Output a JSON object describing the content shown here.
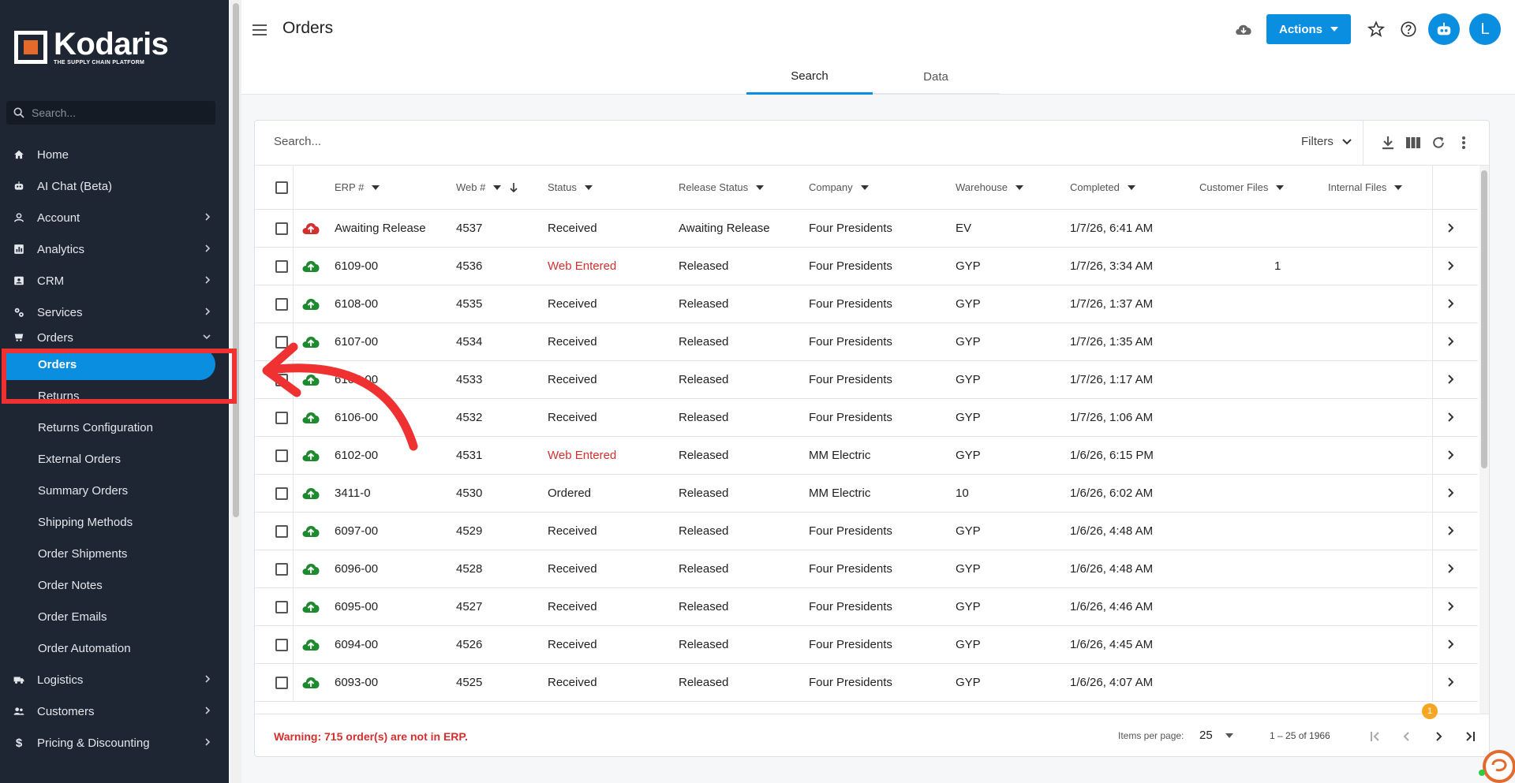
{
  "brand": {
    "name": "Kodaris",
    "tagline": "THE SUPPLY CHAIN PLATFORM"
  },
  "sidebar": {
    "search_placeholder": "Search...",
    "items": [
      {
        "label": "Home",
        "icon": "home-icon"
      },
      {
        "label": "AI Chat (Beta)",
        "icon": "robot-icon"
      },
      {
        "label": "Account",
        "icon": "person-icon",
        "expandable": true
      },
      {
        "label": "Analytics",
        "icon": "chart-icon",
        "expandable": true
      },
      {
        "label": "CRM",
        "icon": "contact-card-icon",
        "expandable": true
      },
      {
        "label": "Services",
        "icon": "services-icon",
        "expandable": true
      },
      {
        "label": "Orders",
        "icon": "orders-icon",
        "expanded": true
      }
    ],
    "orders_sub": [
      {
        "label": "Orders",
        "active": true
      },
      {
        "label": "Returns"
      },
      {
        "label": "Returns Configuration"
      },
      {
        "label": "External Orders"
      },
      {
        "label": "Summary Orders"
      },
      {
        "label": "Shipping Methods"
      },
      {
        "label": "Order Shipments"
      },
      {
        "label": "Order Notes"
      },
      {
        "label": "Order Emails"
      },
      {
        "label": "Order Automation"
      }
    ],
    "bottom_items": [
      {
        "label": "Logistics",
        "icon": "truck-icon"
      },
      {
        "label": "Customers",
        "icon": "people-icon"
      },
      {
        "label": "Pricing & Discounting",
        "icon": "dollar-icon"
      }
    ]
  },
  "header": {
    "title": "Orders",
    "actions_label": "Actions",
    "avatar_initial": "L",
    "tabs": [
      {
        "label": "Search",
        "active": true
      },
      {
        "label": "Data"
      }
    ]
  },
  "toolbar": {
    "search_placeholder": "Search...",
    "filters_label": "Filters"
  },
  "table": {
    "columns": [
      "ERP #",
      "Web #",
      "Status",
      "Release Status",
      "Company",
      "Warehouse",
      "Completed",
      "Customer Files",
      "Internal Files"
    ],
    "rows": [
      {
        "sync": "error",
        "erp": "Awaiting Release",
        "web": "4537",
        "status": "Received",
        "release": "Awaiting Release",
        "company": "Four Presidents",
        "warehouse": "EV",
        "completed": "1/7/26, 6:41 AM",
        "customer_files": "",
        "internal_files": ""
      },
      {
        "sync": "ok",
        "erp": "6109-00",
        "web": "4536",
        "status": "Web Entered",
        "release": "Released",
        "company": "Four Presidents",
        "warehouse": "GYP",
        "completed": "1/7/26, 3:34 AM",
        "customer_files": "1",
        "internal_files": ""
      },
      {
        "sync": "ok",
        "erp": "6108-00",
        "web": "4535",
        "status": "Received",
        "release": "Released",
        "company": "Four Presidents",
        "warehouse": "GYP",
        "completed": "1/7/26, 1:37 AM",
        "customer_files": "",
        "internal_files": ""
      },
      {
        "sync": "ok",
        "erp": "6107-00",
        "web": "4534",
        "status": "Received",
        "release": "Released",
        "company": "Four Presidents",
        "warehouse": "GYP",
        "completed": "1/7/26, 1:35 AM",
        "customer_files": "",
        "internal_files": ""
      },
      {
        "sync": "ok",
        "erp": "6105-00",
        "web": "4533",
        "status": "Received",
        "release": "Released",
        "company": "Four Presidents",
        "warehouse": "GYP",
        "completed": "1/7/26, 1:17 AM",
        "customer_files": "",
        "internal_files": ""
      },
      {
        "sync": "ok",
        "erp": "6106-00",
        "web": "4532",
        "status": "Received",
        "release": "Released",
        "company": "Four Presidents",
        "warehouse": "GYP",
        "completed": "1/7/26, 1:06 AM",
        "customer_files": "",
        "internal_files": ""
      },
      {
        "sync": "ok",
        "erp": "6102-00",
        "web": "4531",
        "status": "Web Entered",
        "release": "Released",
        "company": "MM Electric",
        "warehouse": "GYP",
        "completed": "1/6/26, 6:15 PM",
        "customer_files": "",
        "internal_files": ""
      },
      {
        "sync": "ok",
        "erp": "3411-0",
        "web": "4530",
        "status": "Ordered",
        "release": "Released",
        "company": "MM Electric",
        "warehouse": "10",
        "completed": "1/6/26, 6:02 AM",
        "customer_files": "",
        "internal_files": ""
      },
      {
        "sync": "ok",
        "erp": "6097-00",
        "web": "4529",
        "status": "Received",
        "release": "Released",
        "company": "Four Presidents",
        "warehouse": "GYP",
        "completed": "1/6/26, 4:48 AM",
        "customer_files": "",
        "internal_files": ""
      },
      {
        "sync": "ok",
        "erp": "6096-00",
        "web": "4528",
        "status": "Received",
        "release": "Released",
        "company": "Four Presidents",
        "warehouse": "GYP",
        "completed": "1/6/26, 4:48 AM",
        "customer_files": "",
        "internal_files": ""
      },
      {
        "sync": "ok",
        "erp": "6095-00",
        "web": "4527",
        "status": "Received",
        "release": "Released",
        "company": "Four Presidents",
        "warehouse": "GYP",
        "completed": "1/6/26, 4:46 AM",
        "customer_files": "",
        "internal_files": ""
      },
      {
        "sync": "ok",
        "erp": "6094-00",
        "web": "4526",
        "status": "Received",
        "release": "Released",
        "company": "Four Presidents",
        "warehouse": "GYP",
        "completed": "1/6/26, 4:45 AM",
        "customer_files": "",
        "internal_files": ""
      },
      {
        "sync": "ok",
        "erp": "6093-00",
        "web": "4525",
        "status": "Received",
        "release": "Released",
        "company": "Four Presidents",
        "warehouse": "GYP",
        "completed": "1/6/26, 4:07 AM",
        "customer_files": "",
        "internal_files": ""
      }
    ]
  },
  "footer": {
    "warning": "Warning: 715 order(s) are not in ERP.",
    "items_per_page_label": "Items per page:",
    "items_per_page": "25",
    "range": "1 – 25 of 1966"
  },
  "notification_count": "1",
  "colors": {
    "accent": "#0a8ee0",
    "sidebar_bg": "#1f2633",
    "error": "#d32f2f",
    "success": "#1e8a2e",
    "annotation": "#ef3131"
  }
}
